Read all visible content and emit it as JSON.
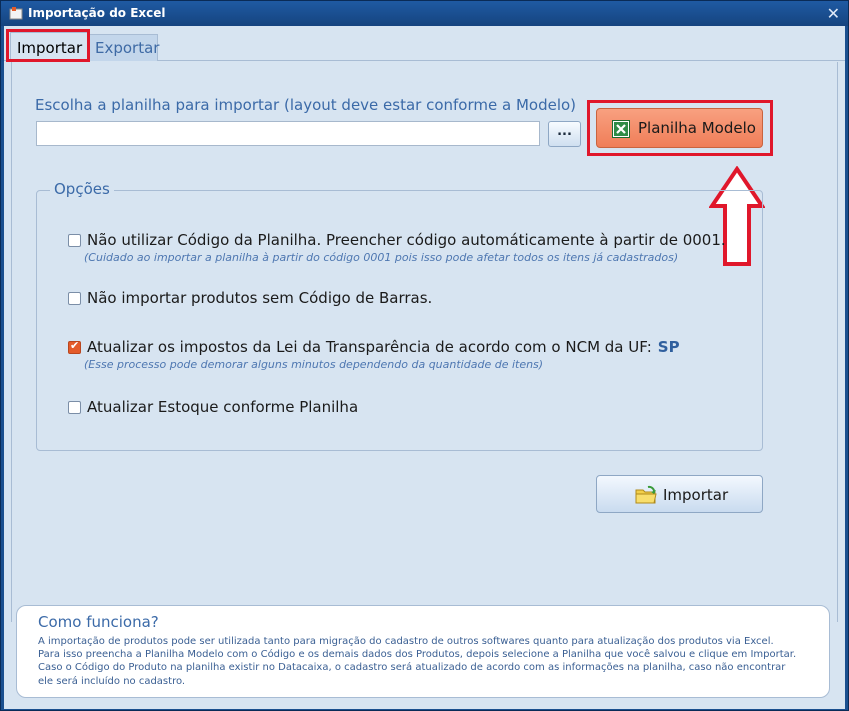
{
  "window": {
    "title": "Importação do Excel",
    "close_glyph": "✕"
  },
  "tabs": [
    {
      "label": "Importar",
      "active": true
    },
    {
      "label": "Exportar",
      "active": false
    }
  ],
  "import": {
    "choose_label": "Escolha a planilha para importar (layout deve estar conforme a Modelo)",
    "path_value": "",
    "browse_label": "...",
    "modelo_button_label": "Planilha Modelo",
    "options_title": "Opções",
    "options": [
      {
        "label": "Não utilizar Código da Planilha. Preencher código automáticamente à partir de 0001.",
        "hint": "(Cuidado ao importar a planilha à partir do código 0001 pois isso pode afetar todos os itens já cadastrados)",
        "checked": false
      },
      {
        "label": "Não importar produtos sem Código de Barras.",
        "hint": "",
        "checked": false
      },
      {
        "label": "Atualizar os impostos da Lei da Transparência de acordo com o NCM da UF:",
        "uf": "SP",
        "hint": "(Esse processo pode demorar alguns minutos dependendo da quantidade de itens)",
        "checked": true
      },
      {
        "label": "Atualizar Estoque conforme Planilha",
        "hint": "",
        "checked": false
      }
    ],
    "importar_button_label": "Importar"
  },
  "howto": {
    "title": "Como funciona?",
    "lines": [
      "A importação de produtos pode ser utilizada tanto para migração do cadastro de outros softwares quanto para atualização dos produtos via Excel.",
      "Para isso preencha a Planilha Modelo com o Código e os demais dados dos Produtos, depois selecione a Planilha que você salvou e clique em Importar.",
      "Caso o Código do Produto na planilha existir no Datacaixa, o cadastro será atualizado de acordo com as informações na planilha, caso não encontrar",
      "ele será incluído no cadastro."
    ]
  },
  "colors": {
    "highlight": "#e0172b",
    "accent_text": "#3b6aa8",
    "checkbox_checked": "#e45b2a",
    "modelo_button": "#f07e58"
  },
  "icons": {
    "app": "app-icon",
    "excel": "excel-icon",
    "folder": "folder-refresh-icon",
    "arrow": "arrow-up-icon"
  }
}
